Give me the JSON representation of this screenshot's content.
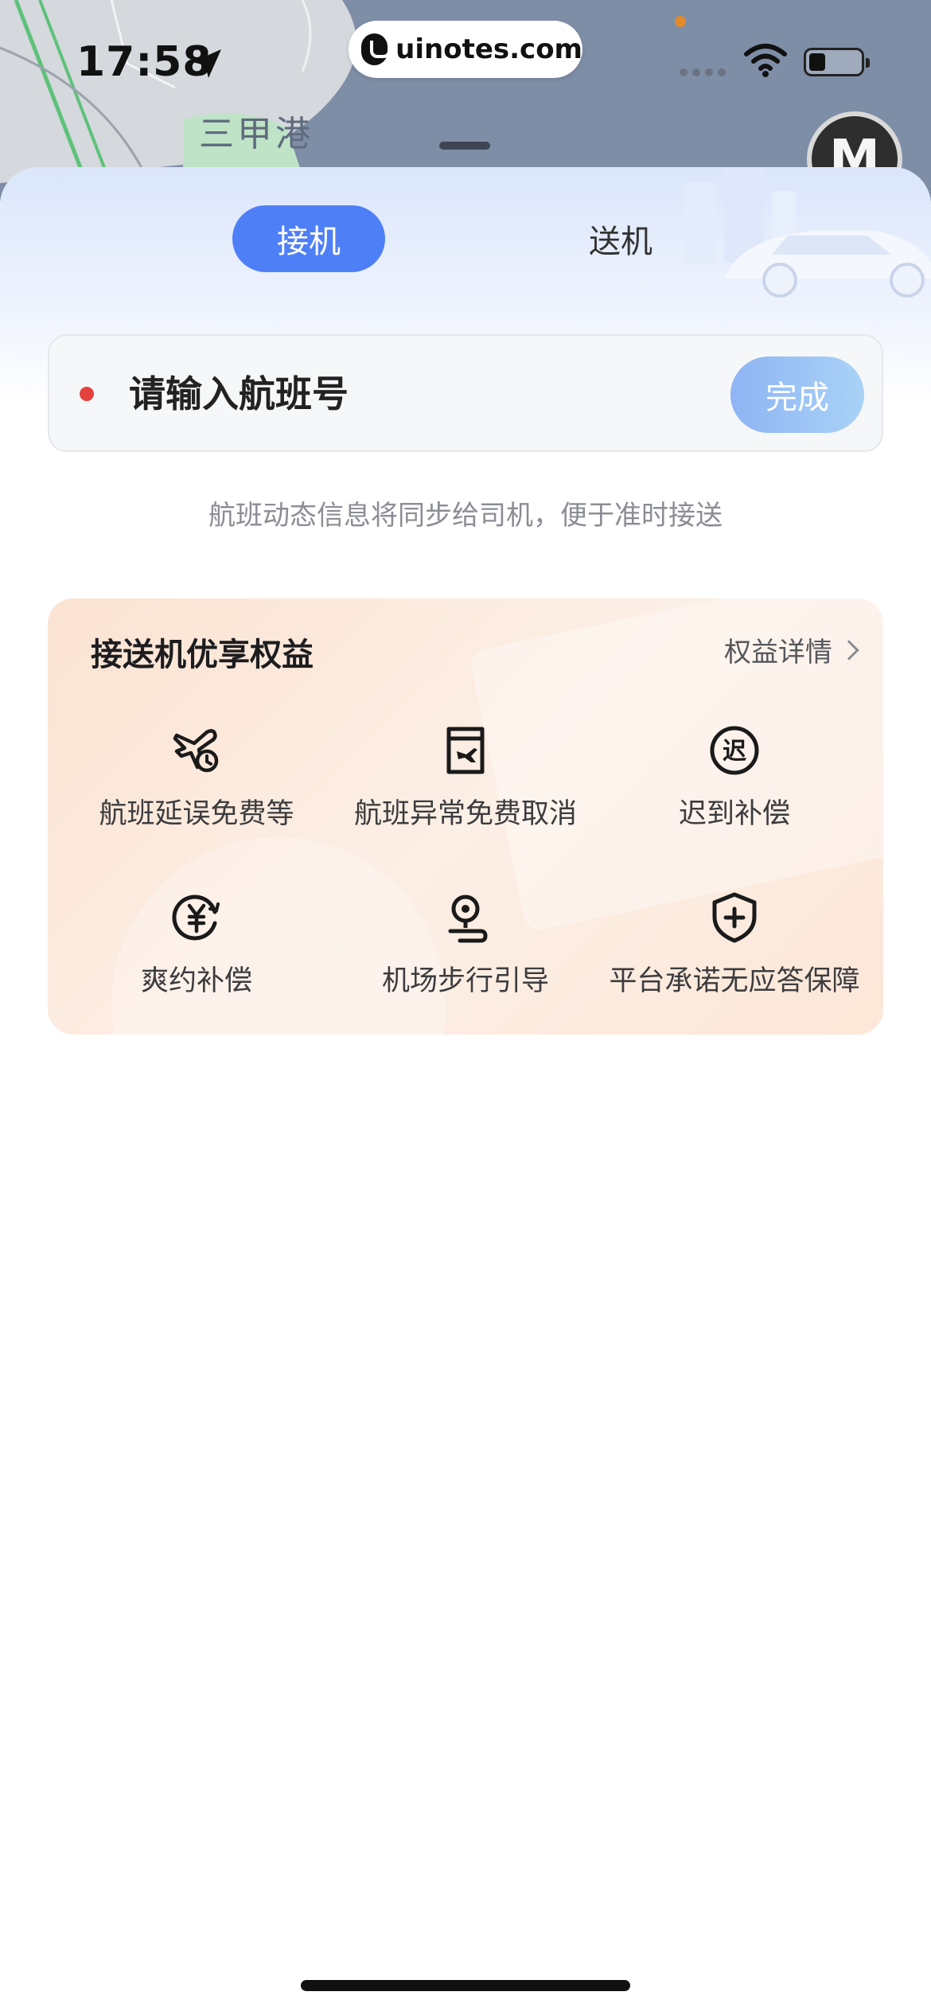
{
  "status_bar": {
    "time": "17:58",
    "url": "uinotes.com"
  },
  "map": {
    "place_label": "三甲港",
    "avatar_letter": "M"
  },
  "tabs": [
    {
      "label": "接机",
      "active": true
    },
    {
      "label": "送机",
      "active": false
    }
  ],
  "flight_input": {
    "placeholder": "请输入航班号",
    "value": "",
    "done_label": "完成"
  },
  "hint": "航班动态信息将同步给司机，便于准时接送",
  "benefits": {
    "title": "接送机优享权益",
    "more_label": "权益详情",
    "items": [
      {
        "label": "航班延误免费等",
        "icon": "plane-clock-icon"
      },
      {
        "label": "航班异常免费取消",
        "icon": "flight-cancel-icon"
      },
      {
        "label": "迟到补偿",
        "icon": "late-badge-icon"
      },
      {
        "label": "爽约补偿",
        "icon": "yuan-refund-icon"
      },
      {
        "label": "机场步行引导",
        "icon": "walk-guide-icon"
      },
      {
        "label": "平台承诺无应答保障",
        "icon": "shield-plus-icon"
      }
    ]
  },
  "colors": {
    "accent": "#4f7ff7",
    "done_button": "#a9c8f5",
    "required_dot": "#e3413e",
    "benefits_bg": "#fbe6d6"
  }
}
